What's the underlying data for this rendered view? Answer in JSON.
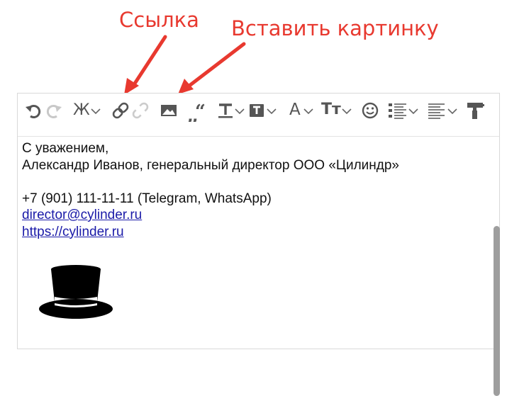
{
  "annotations": {
    "link_label": "Ссылка",
    "image_label": "Вставить картинку"
  },
  "colors": {
    "annotation": "#e8392f",
    "toolbar_icon": "#555555",
    "link": "#1a1aa8",
    "scrollbar": "#9e9e9e"
  },
  "toolbar": {
    "icons": [
      "undo-icon",
      "redo-icon",
      "bold-icon",
      "link-icon",
      "unlink-icon",
      "image-icon",
      "quote-icon",
      "text-color-icon",
      "background-color-icon",
      "font-icon",
      "font-size-icon",
      "emoji-icon",
      "list-icon",
      "align-icon",
      "format-painter-icon"
    ],
    "bold_glyph": "Ж",
    "font_glyph": "A",
    "font_size_glyph": "Тт"
  },
  "signature": {
    "greeting": "С уважением,",
    "name_line": "Александр Иванов, генеральный директор ООО «Цилиндр»",
    "phone_line": "+7 (901) 111-11-11 (Telegram, WhatsApp)",
    "email": "director@cylinder.ru",
    "website": "https://cylinder.ru",
    "logo_icon": "top-hat-icon"
  }
}
